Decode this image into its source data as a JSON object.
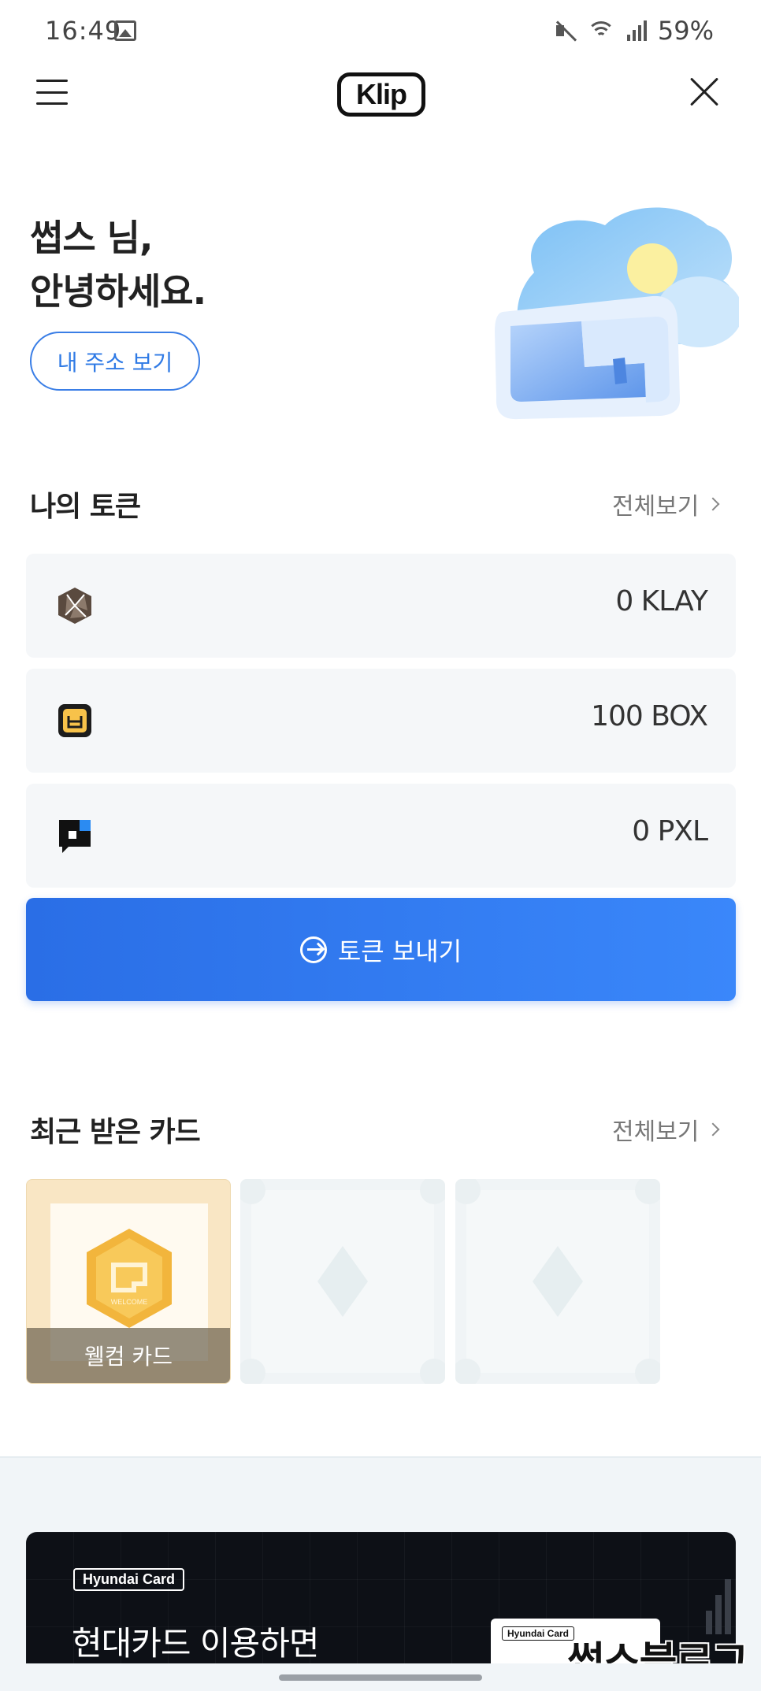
{
  "status_bar": {
    "time": "16:49",
    "battery": "59%"
  },
  "header": {
    "logo_text": "Klip"
  },
  "greeting": {
    "line1": "썹스 님,",
    "line2": "안녕하세요.",
    "address_button": "내 주소 보기"
  },
  "tokens": {
    "title": "나의 토큰",
    "view_all": "전체보기",
    "items": [
      {
        "name": "KLAY",
        "icon": "klay-icon",
        "amount": "0 KLAY"
      },
      {
        "name": "BOX",
        "icon": "box-token-icon",
        "amount": "100 BOX"
      },
      {
        "name": "PXL",
        "icon": "pxl-token-icon",
        "amount": "0 PXL"
      }
    ],
    "send_button": "토큰 보내기"
  },
  "cards": {
    "title": "최근 받은 카드",
    "view_all": "전체보기",
    "items": [
      {
        "label": "웰컴 카드",
        "badge_text": "WELCOME"
      }
    ]
  },
  "banner": {
    "brand": "Hyundai Card",
    "title": "현대카드 이용하면",
    "card_brand": "Hyundai Card"
  },
  "watermark": "썹스블로그",
  "colors": {
    "accent": "#2f7ae5",
    "send_gradient_start": "#2a6ee6",
    "send_gradient_end": "#3a87fa",
    "banner_bg": "#0d1016"
  }
}
